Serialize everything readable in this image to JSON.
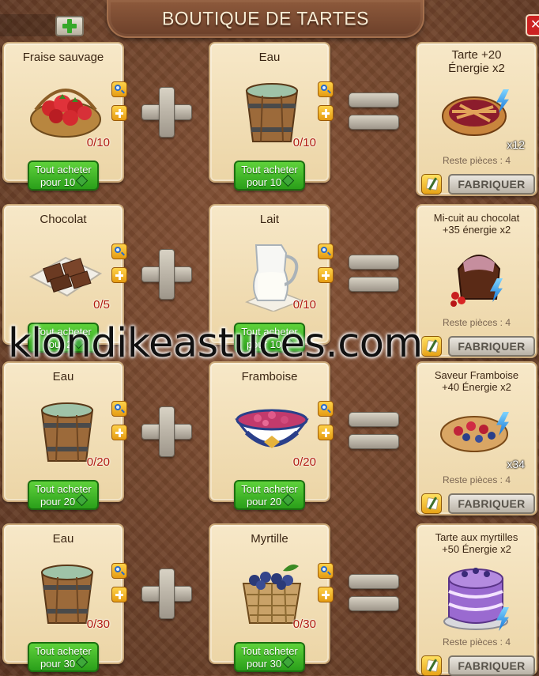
{
  "header": {
    "title": "BOUTIQUE DE TARTES",
    "add_icon": "plus-icon",
    "close_icon": "close-icon",
    "close_glyph": "✕"
  },
  "watermark": "klondikeastuces.com",
  "recipes": [
    {
      "ingredients": [
        {
          "name": "Fraise sauvage",
          "count": "0/10",
          "buy_label": "Tout acheter",
          "buy_price": "pour 10",
          "icon": "strawberry-basket-icon"
        },
        {
          "name": "Eau",
          "count": "0/10",
          "buy_label": "Tout acheter",
          "buy_price": "pour 10",
          "icon": "water-bucket-icon"
        }
      ],
      "result": {
        "name": "Tarte +20\nÉnergie x2",
        "multiplier": "x12",
        "remaining": "Reste pièces : 4",
        "craft_label": "FABRIQUER",
        "icon": "pie-icon"
      }
    },
    {
      "ingredients": [
        {
          "name": "Chocolat",
          "count": "0/5",
          "buy_label": "Tout acheter",
          "buy_price": "pour 2",
          "icon": "chocolate-icon"
        },
        {
          "name": "Lait",
          "count": "0/10",
          "buy_label": "Tout acheter",
          "buy_price": "pour 10",
          "icon": "milk-jug-icon"
        }
      ],
      "result": {
        "name": "Mi-cuit au chocolat\n+35 énergie x2",
        "multiplier": "",
        "remaining": "Reste pièces : 4",
        "craft_label": "FABRIQUER",
        "icon": "lava-cake-icon"
      }
    },
    {
      "ingredients": [
        {
          "name": "Eau",
          "count": "0/20",
          "buy_label": "Tout acheter",
          "buy_price": "pour 20",
          "icon": "water-bucket-icon"
        },
        {
          "name": "Framboise",
          "count": "0/20",
          "buy_label": "Tout acheter",
          "buy_price": "pour 20",
          "icon": "raspberry-bowl-icon"
        }
      ],
      "result": {
        "name": "Saveur Framboise\n+40 Énergie x2",
        "multiplier": "x34",
        "remaining": "Reste pièces : 4",
        "craft_label": "FABRIQUER",
        "icon": "raspberry-tart-icon"
      }
    },
    {
      "ingredients": [
        {
          "name": "Eau",
          "count": "0/30",
          "buy_label": "Tout acheter",
          "buy_price": "pour 30",
          "icon": "water-bucket-icon"
        },
        {
          "name": "Myrtille",
          "count": "0/30",
          "buy_label": "Tout acheter",
          "buy_price": "pour 30",
          "icon": "blueberry-basket-icon"
        }
      ],
      "result": {
        "name": "Tarte aux myrtilles\n+50 Énergie x2",
        "multiplier": "",
        "remaining": "Reste pièces : 4",
        "craft_label": "FABRIQUER",
        "icon": "blueberry-cake-icon"
      }
    }
  ],
  "colors": {
    "background": "#6f432b",
    "card": "#f2dfb6",
    "buy_button": "#3cb326",
    "count_text": "#b0190d",
    "craft_button": "#cfc9be"
  }
}
